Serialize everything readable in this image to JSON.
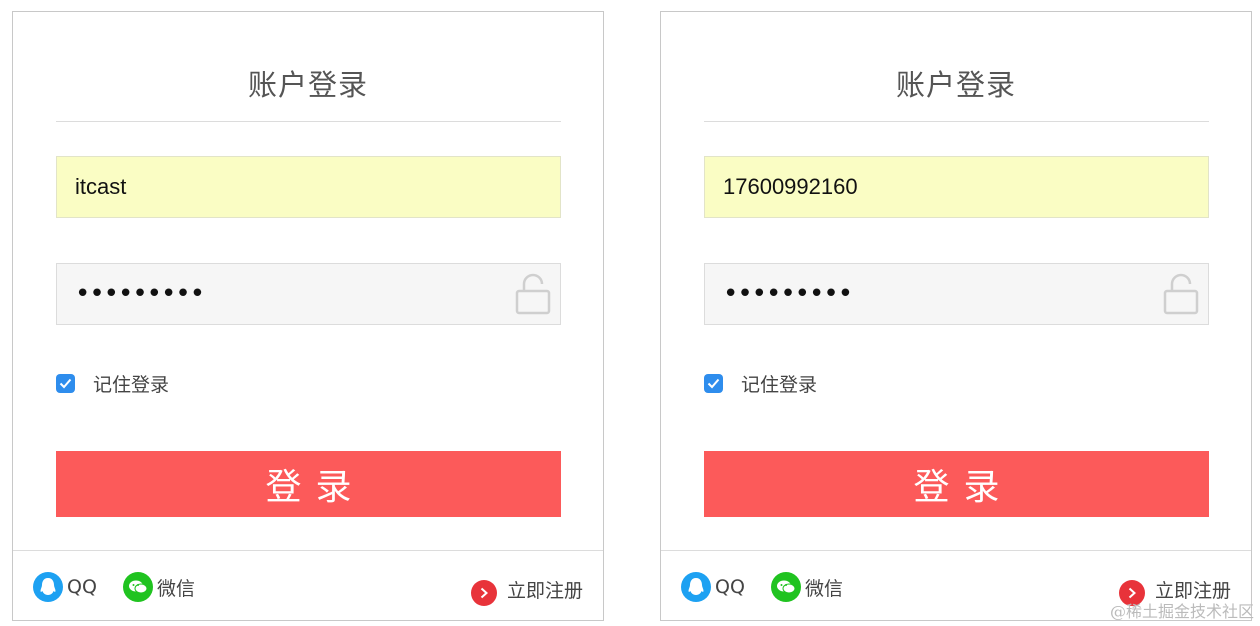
{
  "colors": {
    "accent_red": "#fc5a5a",
    "checkbox_blue": "#2e8ded",
    "autofill_yellow": "#fafdc4",
    "qq_blue": "#1da1f2",
    "wechat_green": "#20c320",
    "register_red": "#e8333a"
  },
  "panels": [
    {
      "title": "账户登录",
      "username_value": "itcast",
      "password_mask": "•••••••••",
      "remember_label": "记住登录",
      "remember_checked": true,
      "login_button": "登录",
      "footer": {
        "qq_label": "QQ",
        "wechat_label": "微信",
        "register_label": "立即注册"
      },
      "icons": [
        "lock-icon",
        "checkmark-icon",
        "qq-icon",
        "wechat-icon",
        "arrow-right-icon"
      ]
    },
    {
      "title": "账户登录",
      "username_value": "17600992160",
      "password_mask": "•••••••••",
      "remember_label": "记住登录",
      "remember_checked": true,
      "login_button": "登录",
      "footer": {
        "qq_label": "QQ",
        "wechat_label": "微信",
        "register_label": "立即注册"
      },
      "icons": [
        "lock-icon",
        "checkmark-icon",
        "qq-icon",
        "wechat-icon",
        "arrow-right-icon"
      ]
    }
  ],
  "watermark": "@稀土掘金技术社区"
}
